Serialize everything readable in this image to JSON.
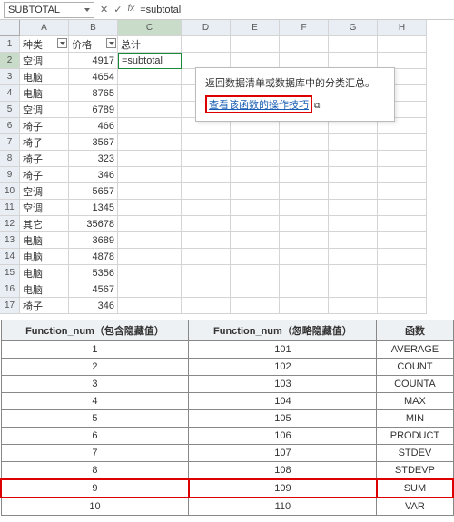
{
  "formula_bar": {
    "cell_ref": "SUBTOTAL",
    "formula_text": "=subtotal",
    "cancel": "✕",
    "confirm": "✓",
    "fx": "fx"
  },
  "columns": [
    "A",
    "B",
    "C",
    "D",
    "E",
    "F",
    "G",
    "H"
  ],
  "headers": {
    "A": "种类",
    "B": "价格",
    "C": "总计"
  },
  "cell_c2": "=subtotal",
  "rows": [
    {
      "n": 2,
      "a": "空调",
      "b": "4917"
    },
    {
      "n": 3,
      "a": "电脑",
      "b": "4654"
    },
    {
      "n": 4,
      "a": "电脑",
      "b": "8765"
    },
    {
      "n": 5,
      "a": "空调",
      "b": "6789"
    },
    {
      "n": 6,
      "a": "椅子",
      "b": "466"
    },
    {
      "n": 7,
      "a": "椅子",
      "b": "3567"
    },
    {
      "n": 8,
      "a": "椅子",
      "b": "323"
    },
    {
      "n": 9,
      "a": "椅子",
      "b": "346"
    },
    {
      "n": 10,
      "a": "空调",
      "b": "5657"
    },
    {
      "n": 11,
      "a": "空调",
      "b": "1345"
    },
    {
      "n": 12,
      "a": "其它",
      "b": "35678"
    },
    {
      "n": 13,
      "a": "电脑",
      "b": "3689"
    },
    {
      "n": 14,
      "a": "电脑",
      "b": "4878"
    },
    {
      "n": 15,
      "a": "电脑",
      "b": "5356"
    },
    {
      "n": 16,
      "a": "电脑",
      "b": "4567"
    },
    {
      "n": 17,
      "a": "椅子",
      "b": "346"
    }
  ],
  "suggest": {
    "fx": "fx",
    "name": "SUBTOTAL"
  },
  "tooltip": {
    "desc": "返回数据清单或数据库中的分类汇总。",
    "link": "查看该函数的操作技巧",
    "popicon": "🔲"
  },
  "ref": {
    "h1": "Function_num（包含隐藏值）",
    "h2": "Function_num（忽略隐藏值）",
    "h3": "函数",
    "rows": [
      {
        "a": "1",
        "b": "101",
        "c": "AVERAGE"
      },
      {
        "a": "2",
        "b": "102",
        "c": "COUNT"
      },
      {
        "a": "3",
        "b": "103",
        "c": "COUNTA"
      },
      {
        "a": "4",
        "b": "104",
        "c": "MAX"
      },
      {
        "a": "5",
        "b": "105",
        "c": "MIN"
      },
      {
        "a": "6",
        "b": "106",
        "c": "PRODUCT"
      },
      {
        "a": "7",
        "b": "107",
        "c": "STDEV"
      },
      {
        "a": "8",
        "b": "108",
        "c": "STDEVP"
      },
      {
        "a": "9",
        "b": "109",
        "c": "SUM",
        "hot": true
      },
      {
        "a": "10",
        "b": "110",
        "c": "VAR"
      }
    ]
  }
}
